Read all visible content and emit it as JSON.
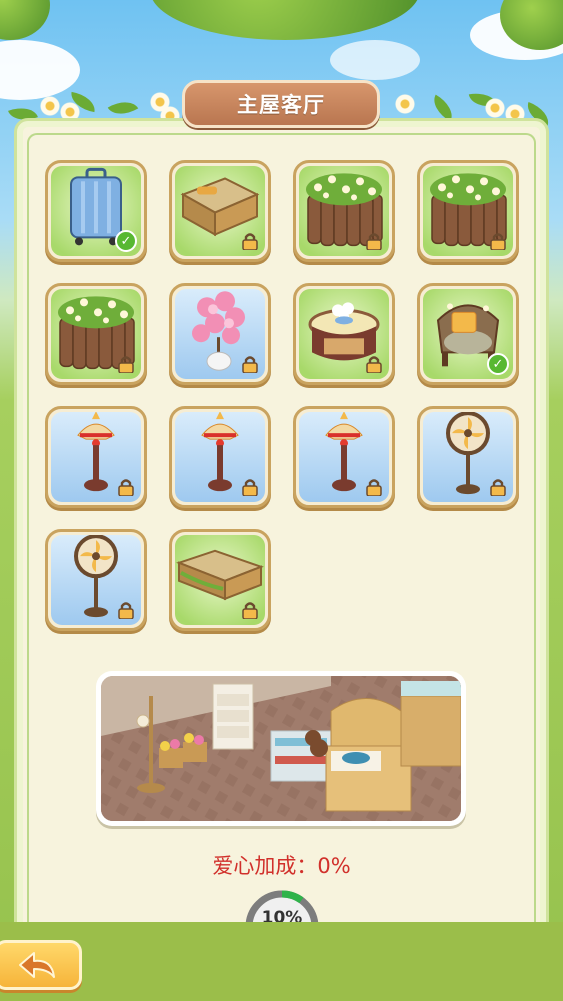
{
  "header": {
    "title": "主屋客厅"
  },
  "items": [
    {
      "name": "suitcase",
      "bg": "green",
      "status": "owned"
    },
    {
      "name": "wooden-bed",
      "bg": "green",
      "status": "locked"
    },
    {
      "name": "flower-fence",
      "bg": "green",
      "status": "locked"
    },
    {
      "name": "flower-fence",
      "bg": "green",
      "status": "locked"
    },
    {
      "name": "flower-fence",
      "bg": "green",
      "status": "locked"
    },
    {
      "name": "cherry-blossom-plant",
      "bg": "blue",
      "status": "locked"
    },
    {
      "name": "round-table",
      "bg": "green",
      "status": "locked"
    },
    {
      "name": "armchair",
      "bg": "green",
      "status": "owned"
    },
    {
      "name": "floor-lamp",
      "bg": "blue",
      "status": "locked"
    },
    {
      "name": "floor-lamp",
      "bg": "blue",
      "status": "locked"
    },
    {
      "name": "floor-lamp",
      "bg": "blue",
      "status": "locked"
    },
    {
      "name": "electric-fan",
      "bg": "blue",
      "status": "locked"
    },
    {
      "name": "electric-fan",
      "bg": "blue",
      "status": "locked"
    },
    {
      "name": "wooden-bench",
      "bg": "green",
      "status": "locked"
    }
  ],
  "bonus": {
    "label": "爱心加成：0%"
  },
  "progress": {
    "value": 10,
    "label": "10%"
  },
  "colors": {
    "bonus_text": "#d1302b",
    "progress_fill": "#2fb34a",
    "title_plate": "#c98660"
  }
}
